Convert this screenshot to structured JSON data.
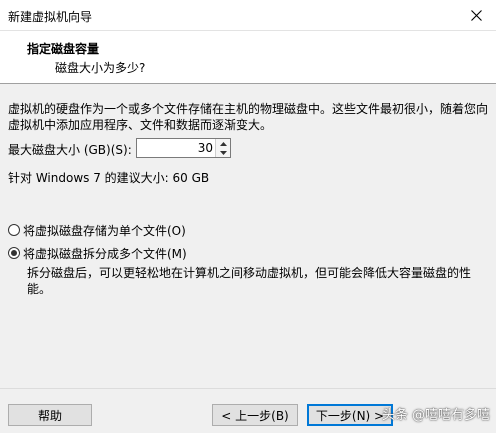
{
  "window": {
    "title": "新建虚拟机向导",
    "close_icon": "close-icon"
  },
  "header": {
    "heading": "指定磁盘容量",
    "subheading": "磁盘大小为多少?"
  },
  "description": "虚拟机的硬盘作为一个或多个文件存储在主机的物理磁盘中。这些文件最初很小，随着您向虚拟机中添加应用程序、文件和数据而逐渐变大。",
  "disk_size": {
    "label": "最大磁盘大小 (GB)(S):",
    "value": "30"
  },
  "recommendation": "针对 Windows 7 的建议大小: 60 GB",
  "options": {
    "single_file": {
      "label": "将虚拟磁盘存储为单个文件(O)",
      "selected": false
    },
    "multiple_files": {
      "label": "将虚拟磁盘拆分成多个文件(M)",
      "selected": true
    },
    "multiple_files_note": "拆分磁盘后，可以更轻松地在计算机之间移动虚拟机，但可能会降低大容量磁盘的性能。"
  },
  "buttons": {
    "help": "帮助",
    "back": "< 上一步(B)",
    "next": "下一步(N) >"
  },
  "watermark": "头条 @嘻嘻有多嘻"
}
